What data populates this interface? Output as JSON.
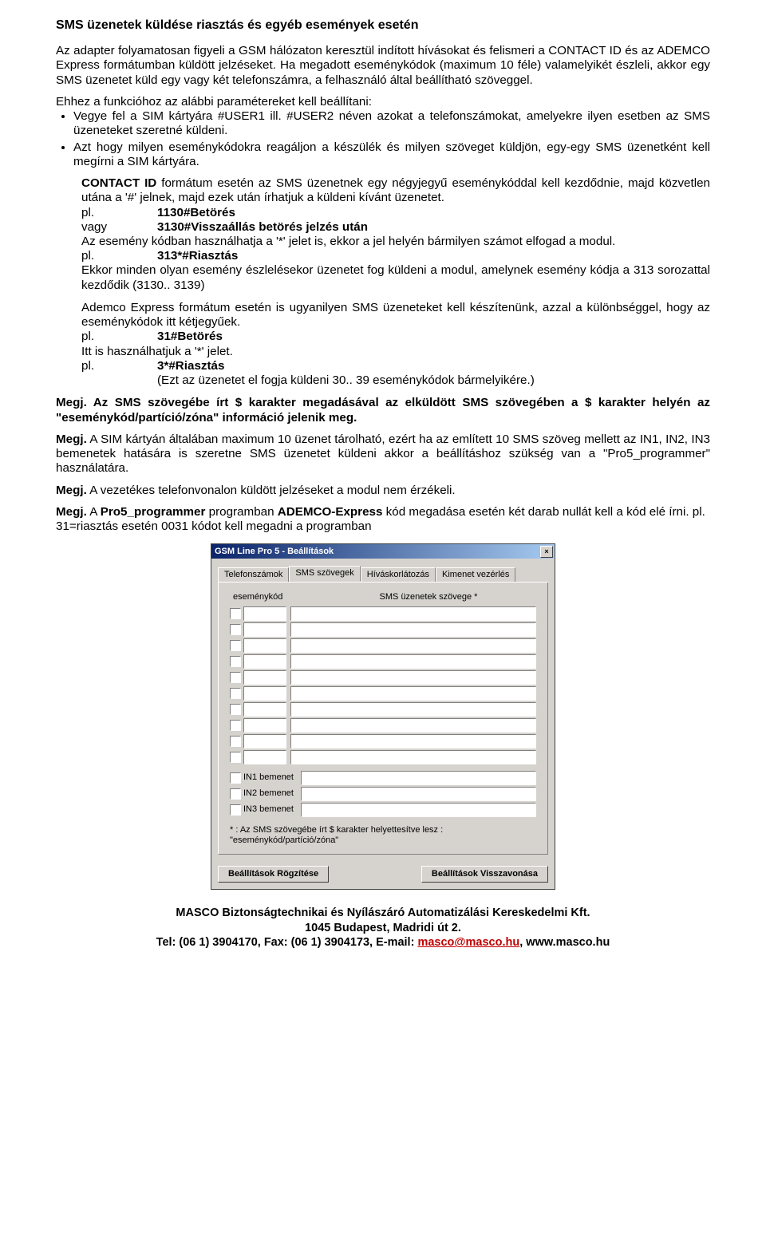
{
  "title": "SMS üzenetek küldése riasztás és egyéb események esetén",
  "intro_p1": "Az adapter folyamatosan figyeli a GSM hálózaton keresztül indított hívásokat és felismeri a CONTACT ID és az ADEMCO Express formátumban küldött jelzéseket. Ha megadott eseménykódok (maximum 10 féle) valamelyikét észleli, akkor egy SMS üzenetet küld egy vagy két telefonszámra, a felhasználó által beállítható szöveggel.",
  "intro_p2": "Ehhez a funkcióhoz az alábbi paramétereket kell beállítani:",
  "bullets": {
    "b1": "Vegye fel a SIM kártyára #USER1 ill. #USER2 néven azokat a telefonszámokat, amelyekre ilyen esetben az SMS üzeneteket szeretné küldeni.",
    "b2": "Azt hogy milyen eseménykódokra reagáljon a készülék és milyen szöveget küldjön, egy-egy SMS üzenetként kell megírni a SIM kártyára."
  },
  "contactid_p1_a": "CONTACT ID",
  "contactid_p1_b": " formátum esetén az SMS üzenetnek egy négyjegyű eseménykóddal kell kezdődnie, majd közvetlen utána a '#' jelnek, majd ezek után írhatjuk a küldeni kívánt üzenetet.",
  "ex1": {
    "pl": "pl.",
    "val": "1130#Betörés"
  },
  "ex2": {
    "pl": "vagy",
    "val": "3130#Visszaállás betörés jelzés után"
  },
  "wildcard_p": "Az esemény kódban használhatja a '*' jelet is, ekkor a jel helyén bármilyen számot elfogad a modul.",
  "ex3": {
    "pl": "pl.",
    "val": "313*#Riasztás"
  },
  "wildcard_after": "Ekkor minden olyan esemény észlelésekor üzenetet fog küldeni a modul, amelynek esemény kódja a 313 sorozattal kezdődik (3130.. 3139)",
  "ademco_p": "Ademco Express formátum esetén is ugyanilyen SMS üzeneteket kell készítenünk, azzal a különbséggel, hogy az eseménykódok itt kétjegyűek.",
  "ex4": {
    "pl": "pl.",
    "val": "31#Betörés"
  },
  "ademco_star": "Itt is használhatjuk a '*' jelet.",
  "ex5": {
    "pl": "pl.",
    "val": "3*#Riasztás"
  },
  "ex5_sub": "(Ezt az üzenetet el fogja küldeni 30.. 39 eseménykódok bármelyikére.)",
  "note1_a": "Megj.",
  "note1_b": " Az SMS szövegébe írt $ karakter megadásával az elküldött SMS szövegében a $ karakter helyén az \"eseménykód/partíció/zóna\" információ jelenik meg.",
  "note2_a": "Megj.",
  "note2_b": " A SIM kártyán általában maximum 10 üzenet tárolható, ezért ha az említett 10 SMS szöveg mellett az IN1, IN2, IN3 bemenetek hatására is szeretne SMS üzenetet küldeni akkor a beállításhoz szükség van a \"Pro5_programmer\" használatára.",
  "note3_a": "Megj.",
  "note3_b": " A vezetékes telefonvonalon küldött jelzéseket a modul nem érzékeli.",
  "note4_a": "Megj.",
  "note4_b": " A ",
  "note4_c": "Pro5_programmer",
  "note4_d": " programban ",
  "note4_e": "ADEMCO-Express",
  "note4_f": " kód megadása esetén két darab nullát kell a kód elé írni.  pl. 31=riasztás esetén 0031 kódot kell megadni a programban",
  "dialog": {
    "title": "GSM Line Pro 5  -  Beállítások",
    "tabs": {
      "t1": "Telefonszámok",
      "t2": "SMS szövegek",
      "t3": "Híváskorlátozás",
      "t4": "Kimenet vezérlés"
    },
    "headers": {
      "h1": "eseménykód",
      "h2": "SMS üzenetek szövege *"
    },
    "in_rows": {
      "r1": "IN1 bemenet",
      "r2": "IN2 bemenet",
      "r3": "IN3 bemenet"
    },
    "note": "* : Az SMS szövegébe írt $ karakter helyettesítve lesz : \"eseménykód/partíció/zóna\"",
    "btn_save": "Beállítások Rögzítése",
    "btn_cancel": "Beállítások Visszavonása"
  },
  "footer": {
    "line1": "MASCO Biztonságtechnikai és Nyílászáró Automatizálási Kereskedelmi Kft.",
    "line2": "1045 Budapest, Madridi út 2.",
    "line3a": "Tel: (06 1) 3904170, Fax: (06 1) 3904173, E-mail: ",
    "line3b": "masco@masco.hu",
    "line3c": ", www.masco.hu"
  }
}
